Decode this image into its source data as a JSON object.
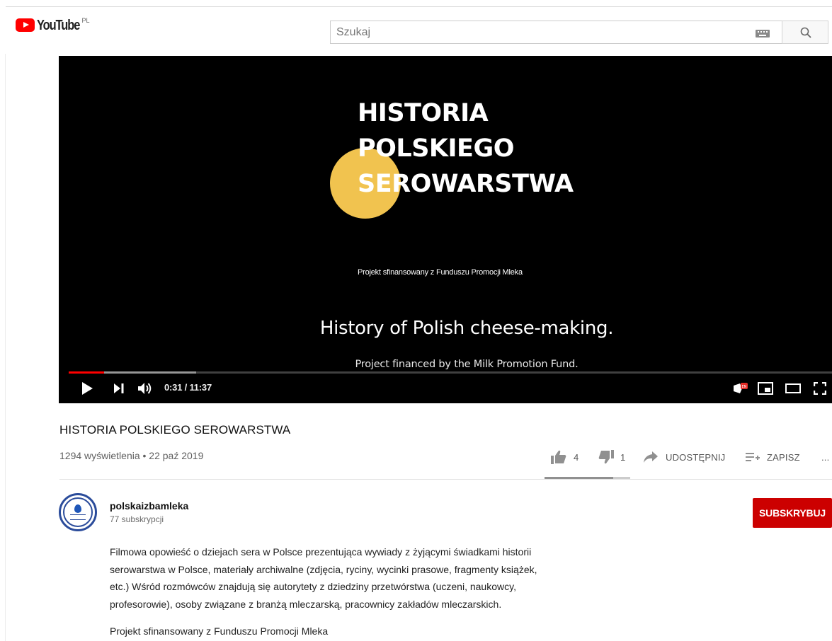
{
  "header": {
    "logo_text": "YouTube",
    "country_code": "PL",
    "search_placeholder": "Szukaj",
    "keyboard_icon": "keyboard-icon",
    "search_icon": "search-icon"
  },
  "player": {
    "slide_title_lines": "HISTORIA\nPOLSKIEGO\nSEROWARSTWA",
    "slide_subtitle": "Projekt sfinansowany z Funduszu Promocji Mleka",
    "caption_line1": "History of Polish cheese-making.",
    "caption_line2": "Project financed by the Milk Promotion Fund.",
    "accent_color": "#f1c34f",
    "progress_played_fraction": 0.046,
    "progress_buffered_fraction": 0.167,
    "time_display": "0:31 / 11:37",
    "controls": {
      "play_icon": "play-icon",
      "next_icon": "next-icon",
      "volume_icon": "volume-icon",
      "subtitles_icon": "subtitles-icon",
      "miniplayer_icon": "miniplayer-icon",
      "theater_icon": "theater-icon",
      "fullscreen_icon": "fullscreen-icon"
    }
  },
  "video": {
    "title": "HISTORIA POLSKIEGO SEROWARSTWA",
    "meta": "1294 wyświetlenia • 22 paź 2019",
    "likes": "4",
    "dislikes": "1",
    "share_label": "UDOSTĘPNIJ",
    "save_label": "ZAPISZ",
    "more_label": "...",
    "like_fraction": 0.8
  },
  "channel": {
    "name": "polskaizbamleka",
    "subscribers": "77 subskrypcji",
    "subscribe_label": "SUBSKRYBUJ",
    "subscribe_color": "#cc0000"
  },
  "description": {
    "paragraph1": "Filmowa opowieść o dziejach sera w Polsce prezentująca wywiady z żyjącymi świadkami historii\nserowarstwa w Polsce, materiały archiwalne (zdjęcia, ryciny, wycinki prasowe, fragmenty książek,\netc.) Wśród rozmówców znajdują się autorytety z dziedziny przetwórstwa (uczeni, naukowcy,\nprofesorowie), osoby związane z branżą mleczarską, pracownicy zakładów mleczarskich.",
    "paragraph2": "Projekt sfinansowany z Funduszu Promocji Mleka"
  }
}
